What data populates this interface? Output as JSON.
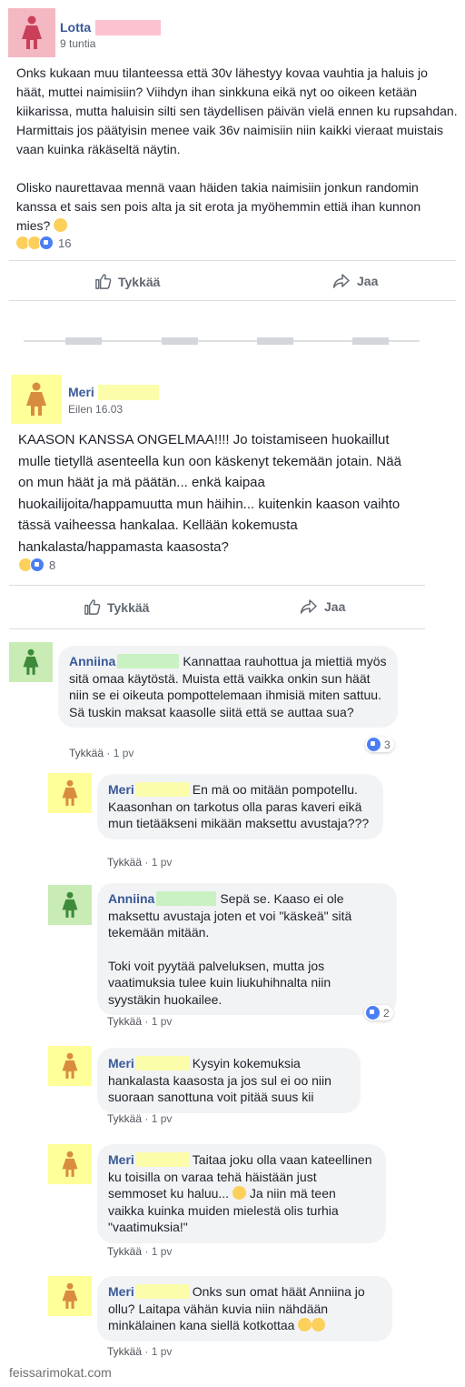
{
  "post1": {
    "author": "Lotta",
    "time": "9 tuntia",
    "text_p1": "Onks kukaan muu tilanteessa että 30v lähestyy kovaa vauhtia ja haluis jo häät, muttei naimisiin? Viihdyn ihan sinkkuna eikä nyt oo oikeen ketään kiikarissa, mutta haluisin silti sen täydellisen päivän vielä ennen ku rupsahdan. Harmittais jos päätyisin menee vaik 36v naimisiin niin kaikki vieraat muistais vaan kuinka räkäseltä näytin.",
    "text_p2": "Olisko naurettavaa mennä vaan häiden takia naimisiin jonkun randomin kanssa et sais sen pois alta ja sit erota ja myöhemmin ettiä ihan kunnon mies?",
    "reaction_count": "16",
    "like_label": "Tykkää",
    "share_label": "Jaa"
  },
  "post2": {
    "author": "Meri",
    "time": "Eilen 16.03",
    "text": "KAASON KANSSA ONGELMAA!!!! Jo toistamiseen huokaillut mulle tietyllä asenteella kun oon käskenyt tekemään jotain. Nää on mun häät ja mä päätän... enkä kaipaa huokailijoita/happamuutta mun häihin... kuitenkin kaason vaihto tässä vaiheessa hankalaa. Kellään kokemusta hankalasta/happamasta kaasosta?",
    "reaction_count": "8",
    "like_label": "Tykkää",
    "share_label": "Jaa"
  },
  "comments": [
    {
      "author": "Anniina",
      "text": "Kannattaa rauhottua ja miettiä myös sitä omaa käytöstä. Muista että vaikka onkin sun häät niin se ei oikeuta pompottelemaan ihmisiä miten sattuu. Sä tuskin maksat kaasolle siitä että se auttaa sua?",
      "like": "Tykkää",
      "time": "1 pv",
      "reacts": "3"
    },
    {
      "author": "Meri",
      "text": "En mä oo mitään pompotellu. Kaasonhan on tarkotus olla paras kaveri eikä mun tietääkseni mikään maksettu avustaja???",
      "like": "Tykkää",
      "time": "1 pv"
    },
    {
      "author": "Anniina",
      "text": "Sepä se. Kaaso ei ole maksettu avustaja joten et voi \"käskeä\" sitä tekemään mitään.",
      "text2": "Toki voit pyytää palveluksen, mutta jos vaatimuksia tulee kuin liukuhihnalta niin syystäkin huokailee.",
      "like": "Tykkää",
      "time": "1 pv",
      "reacts": "2"
    },
    {
      "author": "Meri",
      "text": "Kysyin kokemuksia hankalasta kaasosta ja jos sul ei oo niin suoraan sanottuna voit pitää suus kii",
      "like": "Tykkää",
      "time": "1 pv"
    },
    {
      "author": "Meri",
      "text": "Taitaa joku olla vaan kateellinen ku toisilla on varaa tehä häistään just semmoset ku haluu...",
      "text2": "Ja niin mä teen vaikka kuinka muiden mielestä olis turhia \"vaatimuksia!\"",
      "like": "Tykkää",
      "time": "1 pv"
    },
    {
      "author": "Meri",
      "text": "Onks sun omat häät Anniina jo ollu? Laitapa vähän kuvia niin nähdään minkälainen kana siellä kotkottaa",
      "like": "Tykkää",
      "time": "1 pv"
    }
  ],
  "watermark": "feissarimokat.com",
  "colors": {
    "name_blue": "#385898",
    "pink_avatar": "#f4b8c2",
    "yellow_avatar": "#ffff99",
    "green_avatar": "#c9ebb5",
    "bubble_bg": "#f2f3f5"
  },
  "icons": {
    "avatar": "person-figure-icon",
    "like": "thumbs-up-icon",
    "share": "share-arrow-icon",
    "wow": "wow-reaction-icon",
    "haha": "haha-reaction-icon",
    "like_react": "like-reaction-icon"
  }
}
